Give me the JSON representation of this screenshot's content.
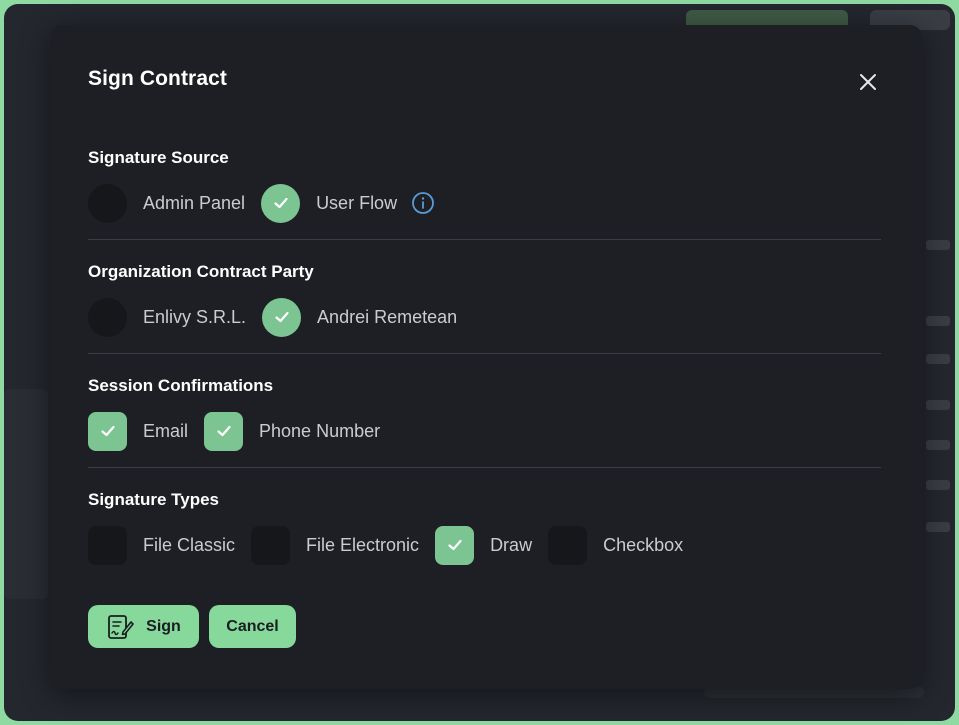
{
  "modal": {
    "title": "Sign Contract"
  },
  "sections": {
    "signature_source": {
      "title": "Signature Source",
      "options": [
        {
          "label": "Admin Panel",
          "checked": false
        },
        {
          "label": "User Flow",
          "checked": true
        }
      ]
    },
    "organization_party": {
      "title": "Organization Contract Party",
      "options": [
        {
          "label": "Enlivy S.R.L.",
          "checked": false
        },
        {
          "label": "Andrei Remetean",
          "checked": true
        }
      ]
    },
    "session_confirmations": {
      "title": "Session Confirmations",
      "options": [
        {
          "label": "Email",
          "checked": true
        },
        {
          "label": "Phone Number",
          "checked": true
        }
      ]
    },
    "signature_types": {
      "title": "Signature Types",
      "options": [
        {
          "label": "File Classic",
          "checked": false
        },
        {
          "label": "File Electronic",
          "checked": false
        },
        {
          "label": "Draw",
          "checked": true
        },
        {
          "label": "Checkbox",
          "checked": false
        }
      ]
    }
  },
  "buttons": {
    "sign_label": "Sign",
    "cancel_label": "Cancel"
  },
  "colors": {
    "accent": "#86d99b",
    "checked": "#7cc592",
    "info": "#5b9bd5"
  },
  "icons": {
    "close": "close-icon",
    "check": "check-icon",
    "info": "info-icon",
    "sign": "contract-sign-icon"
  }
}
